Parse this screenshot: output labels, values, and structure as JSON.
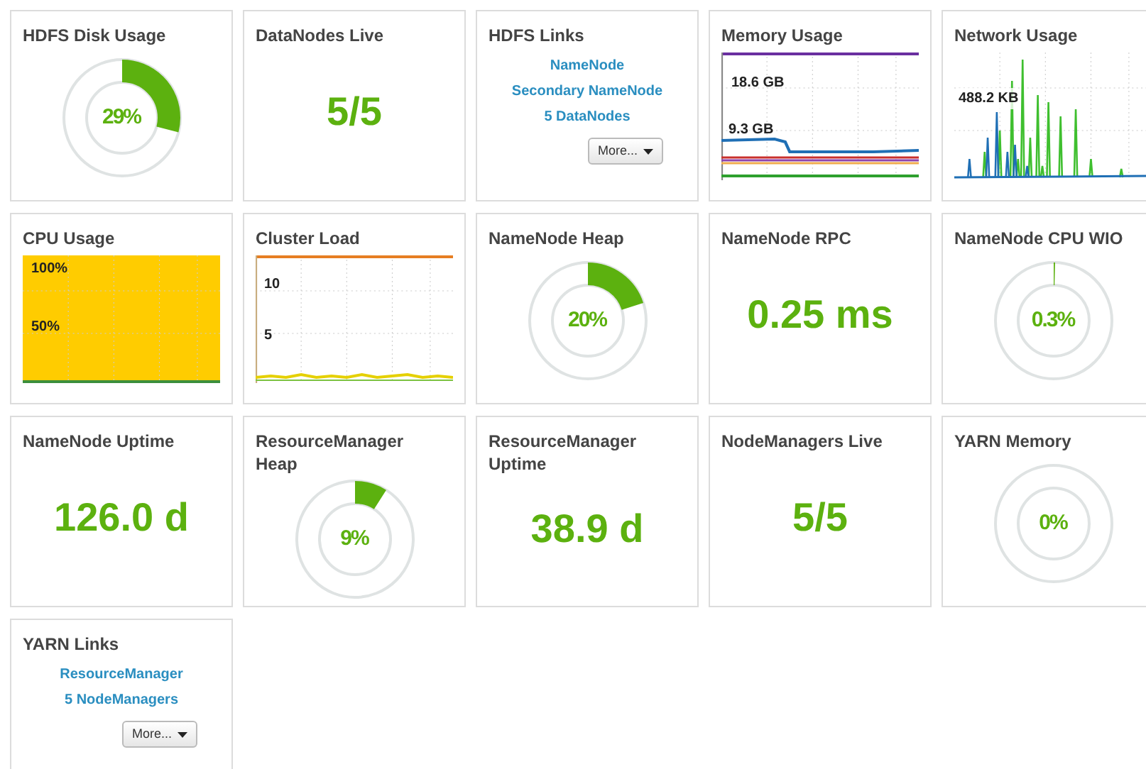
{
  "widgets": [
    {
      "kind": "donut",
      "title": "HDFS Disk Usage",
      "value": "29%",
      "level": 0.29
    },
    {
      "kind": "number",
      "title": "DataNodes Live",
      "value": "5/5"
    },
    {
      "kind": "links",
      "title": "HDFS Links",
      "links": [
        "NameNode",
        "Secondary NameNode",
        "5 DataNodes"
      ],
      "more": "More..."
    },
    {
      "kind": "memory-chart",
      "title": "Memory Usage",
      "labels": [
        "18.6 GB",
        "9.3 GB"
      ]
    },
    {
      "kind": "network-chart",
      "title": "Network Usage",
      "labels": [
        "488.2 KB"
      ]
    },
    {
      "kind": "cpu-chart",
      "title": "CPU Usage",
      "labels": [
        "100%",
        "50%"
      ]
    },
    {
      "kind": "load-chart",
      "title": "Cluster Load",
      "labels": [
        "10",
        "5"
      ]
    },
    {
      "kind": "donut",
      "title": "NameNode Heap",
      "value": "20%",
      "level": 0.2
    },
    {
      "kind": "number",
      "title": "NameNode RPC",
      "value": "0.25 ms"
    },
    {
      "kind": "donut",
      "title": "NameNode CPU WIO",
      "value": "0.3%",
      "level": 0.003
    },
    {
      "kind": "number",
      "title": "NameNode Uptime",
      "value": "126.0 d"
    },
    {
      "kind": "donut",
      "title": "ResourceManager Heap",
      "value": "9%",
      "level": 0.09
    },
    {
      "kind": "number",
      "title": "ResourceManager Uptime",
      "value": "38.9 d"
    },
    {
      "kind": "number",
      "title": "NodeManagers Live",
      "value": "5/5"
    },
    {
      "kind": "donut",
      "title": "YARN Memory",
      "value": "0%",
      "level": 0
    },
    {
      "kind": "links",
      "title": "YARN Links",
      "links": [
        "ResourceManager",
        "5 NodeManagers"
      ],
      "more": "More..."
    }
  ]
}
